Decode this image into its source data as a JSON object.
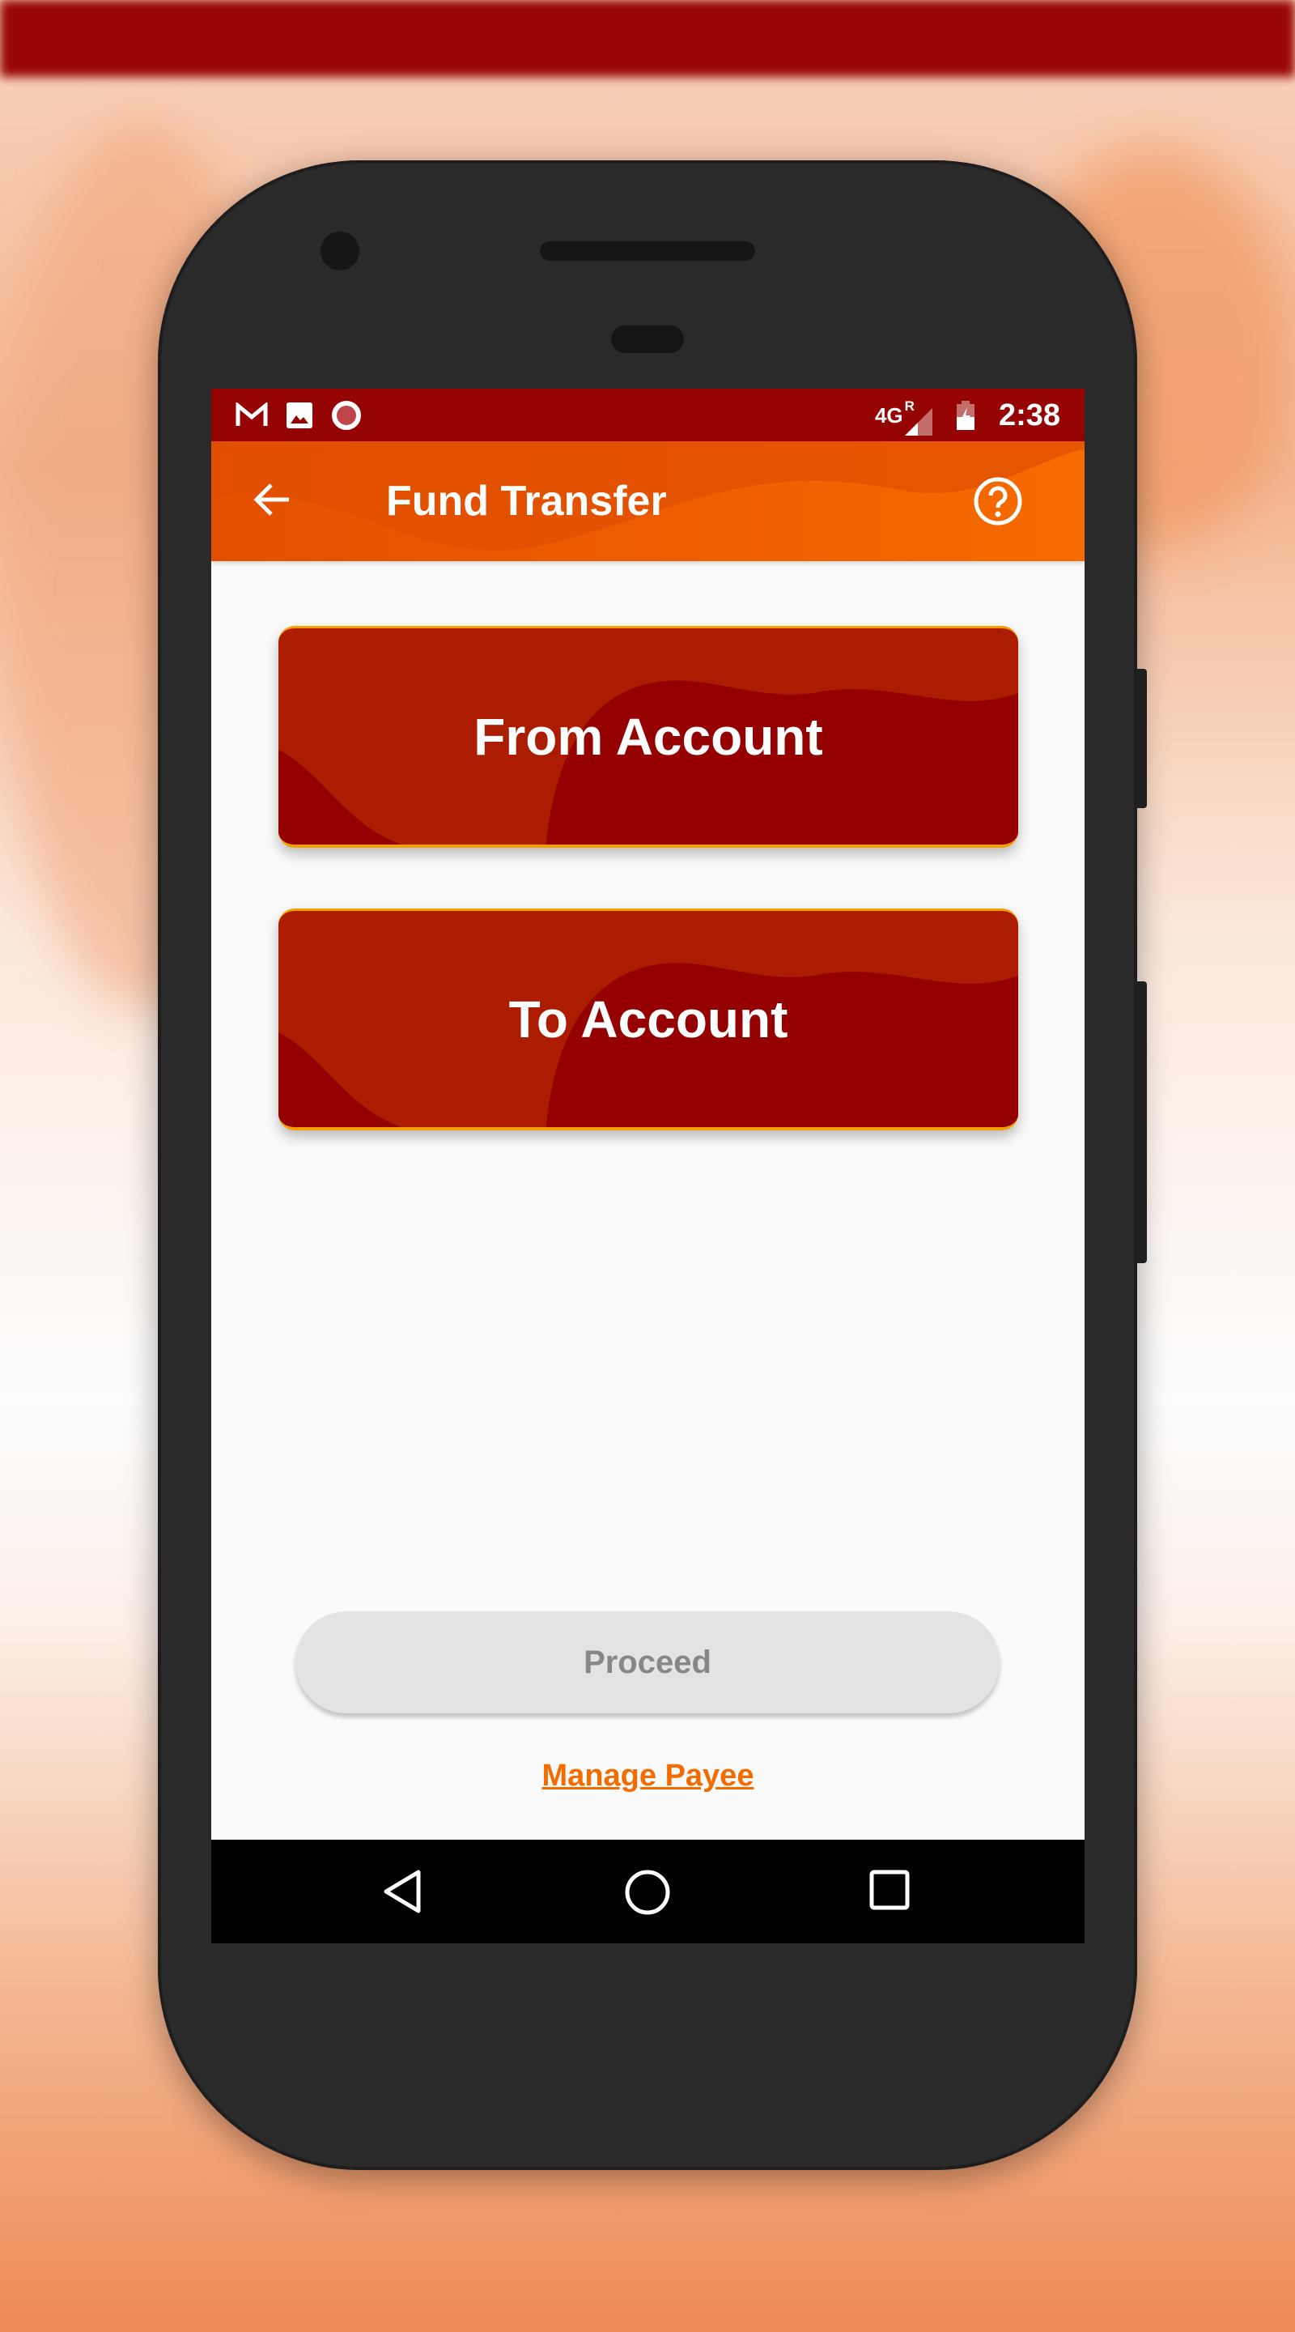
{
  "status_bar": {
    "network": "4G",
    "roaming": "R",
    "time": "2:38",
    "icons": [
      "gmail-icon",
      "image-icon",
      "record-icon",
      "signal-icon",
      "battery-charging-icon"
    ]
  },
  "app_bar": {
    "title": "Fund Transfer",
    "back_icon": "arrow-left-icon",
    "help_icon": "help-circle-icon"
  },
  "cards": [
    {
      "label": "From Account"
    },
    {
      "label": "To Account"
    }
  ],
  "actions": {
    "proceed_label": "Proceed",
    "manage_payee_label": "Manage Payee"
  },
  "nav": [
    "back-icon",
    "home-icon",
    "recents-icon"
  ],
  "colors": {
    "primary": "#f36c00",
    "status_bar": "#950303",
    "card": "#ab1c00",
    "card_dark": "#940000",
    "card_border": "#f5a000",
    "disabled_button": "#e3e3e3"
  }
}
